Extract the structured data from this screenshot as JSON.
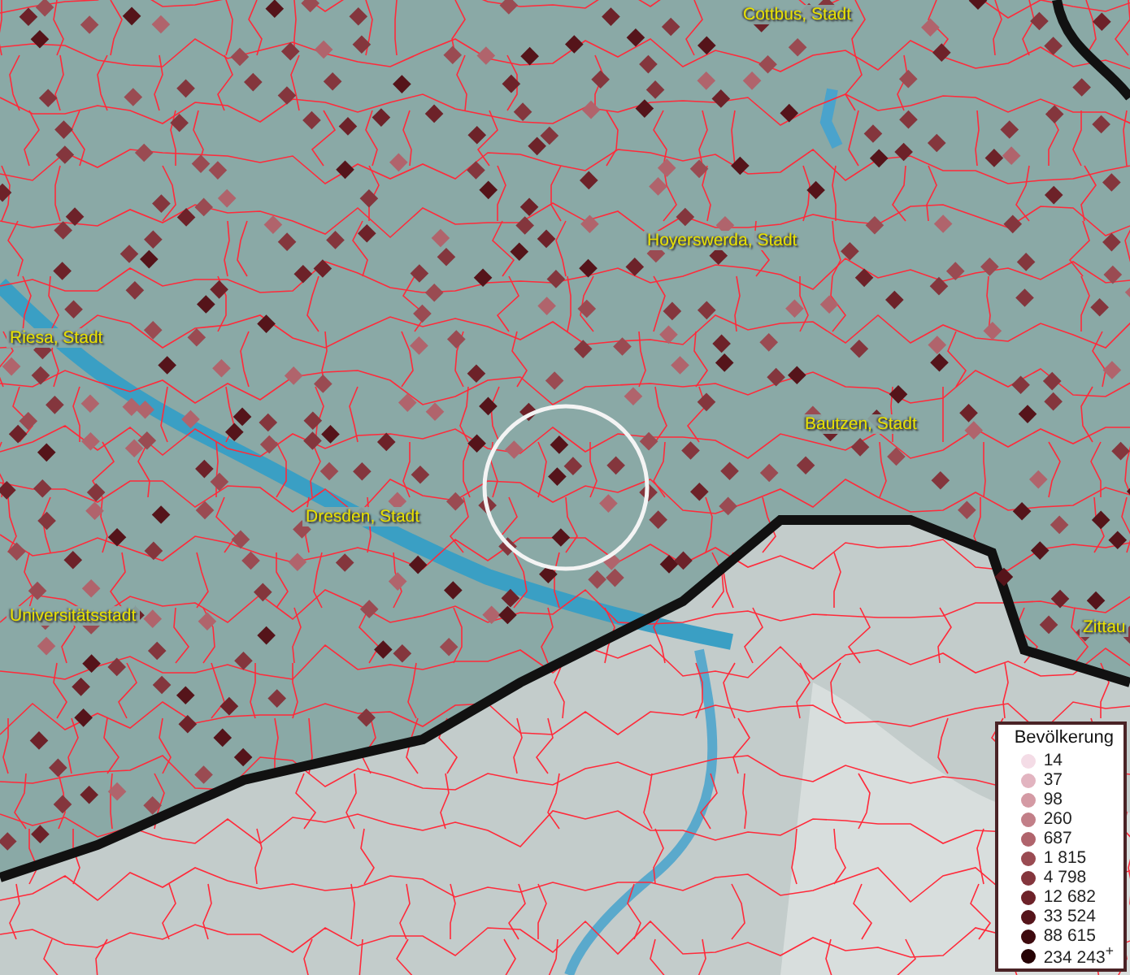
{
  "map": {
    "places": [
      {
        "name": "Cottbus, Stadt"
      },
      {
        "name": "Hoyerswerda, Stadt"
      },
      {
        "name": "Riesa, Stadt"
      },
      {
        "name": "Bautzen, Stadt"
      },
      {
        "name": "Dresden, Stadt"
      },
      {
        "name": "Universitätsstadt"
      },
      {
        "name": "Zittau"
      }
    ]
  },
  "legend": {
    "title": "Bevölkerung",
    "items": [
      {
        "label": "14",
        "color": "#f4dce6"
      },
      {
        "label": "37",
        "color": "#e2b4c0"
      },
      {
        "label": "98",
        "color": "#d49aa4"
      },
      {
        "label": "260",
        "color": "#c27f88"
      },
      {
        "label": "687",
        "color": "#b0646c"
      },
      {
        "label": "1 815",
        "color": "#9a4b52"
      },
      {
        "label": "4 798",
        "color": "#84363d"
      },
      {
        "label": "12 682",
        "color": "#6d2229"
      },
      {
        "label": "33 524",
        "color": "#55141a"
      },
      {
        "label": "88 615",
        "color": "#3e0a0e"
      },
      {
        "label": "234 243$^{+}$",
        "color": "#260305"
      }
    ]
  }
}
